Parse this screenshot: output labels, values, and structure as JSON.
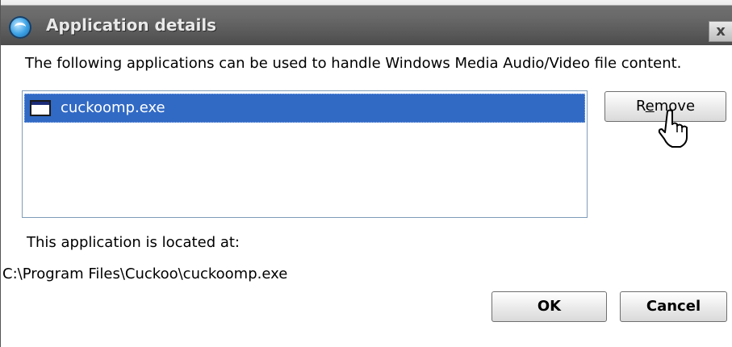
{
  "window": {
    "title": "Application details",
    "close_glyph": "x"
  },
  "description": "The following applications can be used to handle Windows Media Audio/Video file content.",
  "app_list": {
    "items": [
      {
        "label": "cuckoomp.exe",
        "icon": "window-icon",
        "selected": true
      }
    ]
  },
  "buttons": {
    "remove": {
      "prefix": "R",
      "accel": "e",
      "rest": "move"
    },
    "ok": "OK",
    "cancel": "Cancel"
  },
  "location": {
    "label": "This application is located at:",
    "path": "C:\\Program Files\\Cuckoo\\cuckoomp.exe"
  },
  "colors": {
    "selection": "#316ac5",
    "titlebar": "#5a5a5a"
  },
  "cursor": "hand-pointer-icon"
}
